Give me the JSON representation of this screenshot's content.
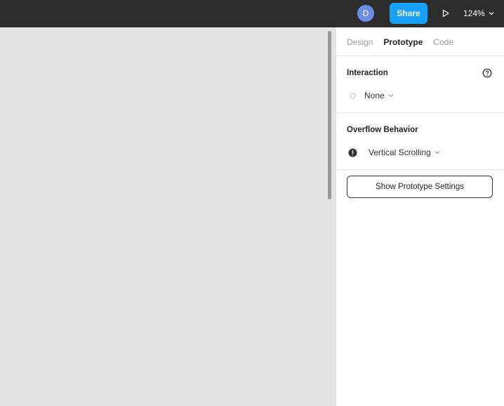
{
  "topbar": {
    "avatar_initial": "D",
    "share_label": "Share",
    "zoom_label": "124%"
  },
  "panel": {
    "tabs": [
      {
        "label": "Design",
        "active": false
      },
      {
        "label": "Prototype",
        "active": true
      },
      {
        "label": "Code",
        "active": false
      }
    ],
    "interaction": {
      "title": "Interaction",
      "value": "None"
    },
    "overflow": {
      "title": "Overflow Behavior",
      "value": "Vertical Scrolling"
    },
    "settings_button_label": "Show Prototype Settings"
  },
  "colors": {
    "topbar_bg": "#2c2c2c",
    "share_blue": "#18a0fb",
    "avatar_blue": "#6d8ce6",
    "canvas_bg": "#e5e5e5",
    "panel_bg": "#ffffff"
  }
}
